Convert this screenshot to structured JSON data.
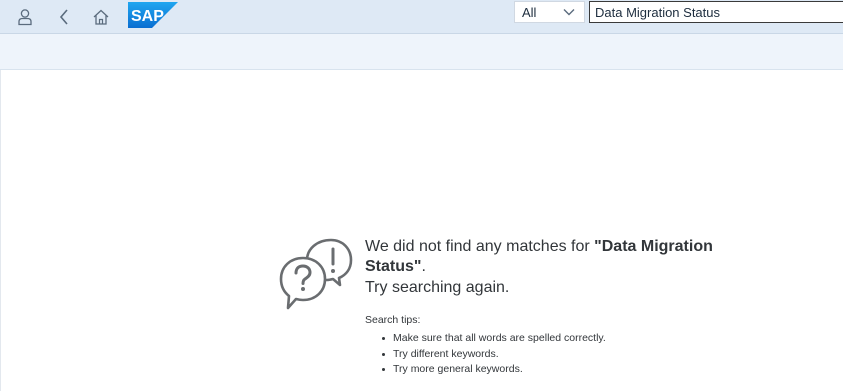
{
  "header": {
    "icons": {
      "user": "user-icon",
      "back": "back-arrow-icon",
      "home": "home-icon"
    },
    "logo_text": "SAP",
    "search": {
      "scope_value": "All",
      "query_value": "Data Migration Status"
    },
    "colors": {
      "bar": "#dee9f5",
      "logo": "#1a8be0"
    }
  },
  "empty_state": {
    "icon": "speech-bubbles-question-exclamation-icon",
    "message_prefix": "We did not find any matches for ",
    "message_query": "\"Data Migration Status\"",
    "message_suffix": ".",
    "message_again": "Try searching again.",
    "tips_title": "Search tips:",
    "tips": [
      "Make sure that all words are spelled correctly.",
      "Try different keywords.",
      "Try more general keywords."
    ]
  }
}
